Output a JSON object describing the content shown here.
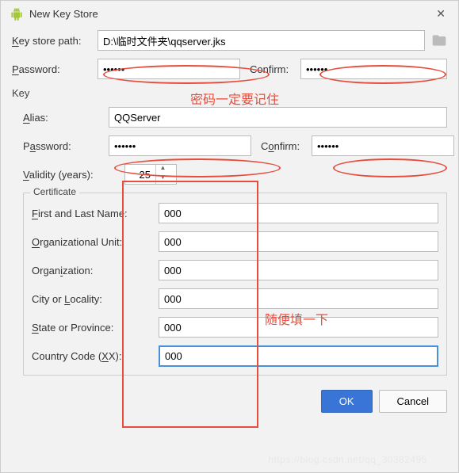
{
  "titlebar": {
    "title": "New Key Store"
  },
  "keystore": {
    "path_label": "Key store path:",
    "path_value": "D:\\临时文件夹\\qqserver.jks",
    "password_label": "Password:",
    "password_value": "••••••",
    "confirm_label": "Confirm:",
    "confirm_value": "••••••"
  },
  "key_section_label": "Key",
  "key": {
    "alias_label": "Alias:",
    "alias_value": "QQServer",
    "password_label": "Password:",
    "password_value": "••••••",
    "confirm_label": "Confirm:",
    "confirm_value": "••••••",
    "validity_label": "Validity (years):",
    "validity_value": "25"
  },
  "certificate": {
    "legend": "Certificate",
    "first_last_label": "First and Last Name:",
    "first_last_value": "000",
    "org_unit_label": "Organizational Unit:",
    "org_unit_value": "000",
    "org_label": "Organization:",
    "org_value": "000",
    "city_label": "City or Locality:",
    "city_value": "000",
    "state_label": "State or Province:",
    "state_value": "000",
    "country_label": "Country Code (XX):",
    "country_value": "000"
  },
  "buttons": {
    "ok": "OK",
    "cancel": "Cancel"
  },
  "annotations": {
    "password_note": "密码一定要记住",
    "cert_note": "随便填一下"
  },
  "watermark": "https://blog.csdn.net/qq_30382495"
}
